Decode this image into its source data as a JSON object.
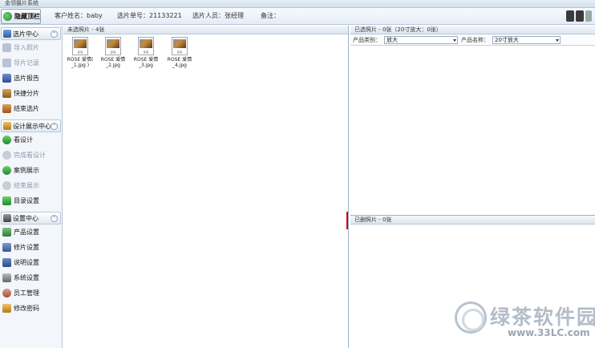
{
  "window": {
    "title": "金领摄片系统"
  },
  "infobar": {
    "hide_button": "隐藏顶栏",
    "customer": "客户姓名：baby",
    "order": "选片单号：21133221",
    "staff": "选片人员：张经理",
    "note": "备注："
  },
  "sidebar": {
    "groups": [
      {
        "label": "选片中心",
        "icon": "select-photo-icon",
        "items": [
          {
            "label": "导入照片",
            "icon": "import-icon",
            "enabled": false
          },
          {
            "label": "导片记录",
            "icon": "import-record-icon",
            "enabled": false
          },
          {
            "label": "选片报告",
            "icon": "report-icon",
            "enabled": true
          },
          {
            "label": "快捷分片",
            "icon": "quick-split-icon",
            "enabled": true
          },
          {
            "label": "结束选片",
            "icon": "finish-icon",
            "enabled": true
          }
        ]
      },
      {
        "label": "设计展示中心",
        "icon": "design-center-icon",
        "items": [
          {
            "label": "看设计",
            "icon": "view-design-icon",
            "enabled": true
          },
          {
            "label": "完成看设计",
            "icon": "done-design-icon",
            "enabled": false
          },
          {
            "label": "案例展示",
            "icon": "case-icon",
            "enabled": true
          },
          {
            "label": "结束展示",
            "icon": "end-show-icon",
            "enabled": false
          },
          {
            "label": "目录设置",
            "icon": "catalog-icon",
            "enabled": true
          }
        ]
      },
      {
        "label": "设置中心",
        "icon": "settings-center-icon",
        "items": [
          {
            "label": "产品设置",
            "icon": "product-settings-icon",
            "enabled": true
          },
          {
            "label": "修片设置",
            "icon": "retouch-settings-icon",
            "enabled": true
          },
          {
            "label": "说明设置",
            "icon": "note-settings-icon",
            "enabled": true
          },
          {
            "label": "系统设置",
            "icon": "system-settings-icon",
            "enabled": true
          },
          {
            "label": "员工管理",
            "icon": "staff-icon",
            "enabled": true
          },
          {
            "label": "修改密码",
            "icon": "password-icon",
            "enabled": true
          }
        ]
      }
    ]
  },
  "unselected": {
    "header": "未选照片 - 4张",
    "photos": [
      {
        "caption": "ROSE 爱情( _1.jpg )"
      },
      {
        "caption": "ROSE 爱情_2.jpg"
      },
      {
        "caption": "ROSE 爱情_3.jpg"
      },
      {
        "caption": "ROSE 爱情_4.jpg"
      }
    ]
  },
  "selected": {
    "header": "已选照片 - 0张（20寸放大：0张）",
    "category_label": "产品类别：",
    "category_value": "放大",
    "name_label": "产品名称：",
    "name_value": "20寸放大"
  },
  "deleted": {
    "header": "已删照片 - 0张"
  },
  "watermark": {
    "brand": "绿茶软件园",
    "url": "www.33LC.com"
  },
  "colors": {
    "accent": "#1d8a2d",
    "splitter": "#cc0000",
    "panel_header": "#dde6f0"
  }
}
